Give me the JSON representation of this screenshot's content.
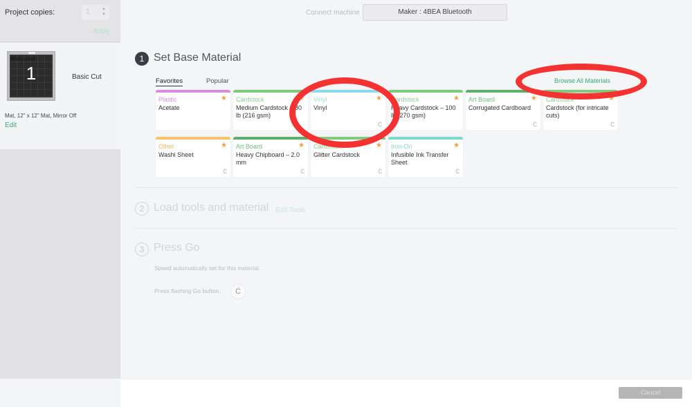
{
  "sidebar": {
    "copies_label": "Project copies:",
    "copies_value": "1",
    "apply_label": "Apply",
    "mat": {
      "number": "1",
      "scribble": "Welcome",
      "name": "Basic Cut",
      "description": "Mat, 12\" x 12\" Mat, Mirror Off",
      "edit_label": "Edit"
    }
  },
  "header": {
    "connect_label": "Connect machine",
    "machine_label": "Maker : 4BEA Bluetooth"
  },
  "steps": [
    {
      "number": "1",
      "title": "Set Base Material"
    },
    {
      "number": "2",
      "title": "Load tools and material",
      "link": "Edit Tools"
    },
    {
      "number": "3",
      "title": "Press Go",
      "speed_text": "Speed automatically set for this material.",
      "press_text": "Press flashing Go button."
    }
  ],
  "materials": {
    "tabs": [
      {
        "label": "Favorites",
        "active": true
      },
      {
        "label": "Popular",
        "active": false
      }
    ],
    "browse_label": "Browse All Materials",
    "cards": [
      {
        "category": "Plastic",
        "name": "Acetate",
        "color": "#d98be0",
        "cat_color": "#d98be0",
        "starred": true,
        "cut_icon": false
      },
      {
        "category": "Cardstock",
        "name": "Medium Cardstock – 80 lb (216 gsm)",
        "color": "#7ecb7e",
        "cat_color": "#8fd18f",
        "starred": true,
        "cut_icon": false
      },
      {
        "category": "Vinyl",
        "name": "Vinyl",
        "color": "#8fdaea",
        "cat_color": "#9ad6e6",
        "starred": true,
        "cut_icon": true
      },
      {
        "category": "Cardstock",
        "name": "Heavy Cardstock – 100 lb (270 gsm)",
        "color": "#7ecb7e",
        "cat_color": "#8fd18f",
        "starred": true,
        "cut_icon": false
      },
      {
        "category": "Art Board",
        "name": "Corrugated Cardboard",
        "color": "#5fae6e",
        "cat_color": "#6fbb7c",
        "starred": true,
        "cut_icon": true
      },
      {
        "category": "Cardstock",
        "name": "Cardstock (for intricate cuts)",
        "color": "#7ecb7e",
        "cat_color": "#8fd18f",
        "starred": true,
        "cut_icon": true
      },
      {
        "category": "Other",
        "name": "Washi Sheet",
        "color": "#f6c46a",
        "cat_color": "#f0b860",
        "starred": true,
        "cut_icon": true
      },
      {
        "category": "Art Board",
        "name": "Heavy Chipboard – 2.0 mm",
        "color": "#5fae6e",
        "cat_color": "#6fbb7c",
        "starred": true,
        "cut_icon": true
      },
      {
        "category": "Cardstock",
        "name": "Glitter Cardstock",
        "color": "#7ecb7e",
        "cat_color": "#8fd18f",
        "starred": true,
        "cut_icon": true
      },
      {
        "category": "Iron-On",
        "name": "Infusible Ink Transfer Sheet",
        "color": "#7fd8cc",
        "cat_color": "#8fd8d0",
        "starred": true,
        "cut_icon": true
      }
    ]
  },
  "footer": {
    "cancel_label": "Cancel"
  },
  "icons": {
    "star": "★",
    "cut": "C̈",
    "go": "Ć",
    "step_up": "▲",
    "step_down": "▼"
  },
  "colors": {
    "accent": "#3aa87a",
    "annotation": "#f43232",
    "star": "#f0a43c"
  }
}
